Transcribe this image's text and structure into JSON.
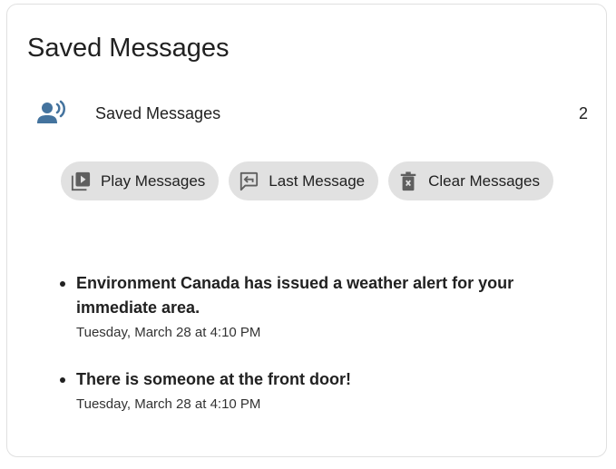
{
  "card": {
    "title": "Saved Messages"
  },
  "entity": {
    "icon": "account-voice-icon",
    "name": "Saved Messages",
    "state": "2"
  },
  "buttons": [
    {
      "label": "Play Messages",
      "icon": "play-box-multiple-icon"
    },
    {
      "label": "Last Message",
      "icon": "message-reply-icon"
    },
    {
      "label": "Clear Messages",
      "icon": "trash-icon"
    }
  ],
  "messages": [
    {
      "text": "Environment Canada has issued a weather alert for your immediate area.",
      "time": "Tuesday, March 28 at 4:10 PM"
    },
    {
      "text": "There is someone at the front door!",
      "time": "Tuesday, March 28 at 4:10 PM"
    }
  ],
  "colors": {
    "icon_blue": "#44739e",
    "chip_bg": "#e1e1e1",
    "text": "#212121",
    "chip_icon": "#5f5f5f"
  }
}
